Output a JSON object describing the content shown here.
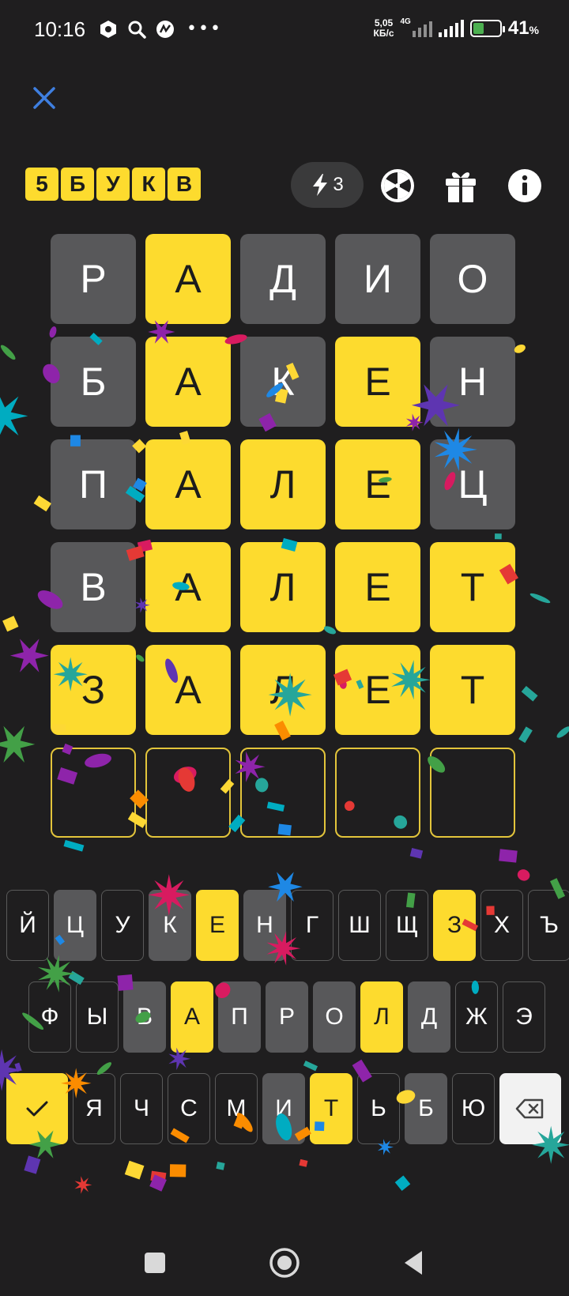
{
  "status_bar": {
    "time": "10:16",
    "speed_value": "5,05",
    "speed_unit": "КБ/с",
    "network": "4G",
    "battery_pct": "41",
    "battery_unit": "%",
    "battery_level": 0.41
  },
  "header": {
    "logo_letters": [
      "5",
      "Б",
      "У",
      "К",
      "В"
    ],
    "energy_count": "3"
  },
  "grid": {
    "rows": [
      [
        {
          "l": "Р",
          "s": "gray"
        },
        {
          "l": "А",
          "s": "yellow"
        },
        {
          "l": "Д",
          "s": "gray"
        },
        {
          "l": "И",
          "s": "gray"
        },
        {
          "l": "О",
          "s": "gray"
        }
      ],
      [
        {
          "l": "Б",
          "s": "gray"
        },
        {
          "l": "А",
          "s": "yellow"
        },
        {
          "l": "К",
          "s": "gray"
        },
        {
          "l": "Е",
          "s": "yellow"
        },
        {
          "l": "Н",
          "s": "gray"
        }
      ],
      [
        {
          "l": "П",
          "s": "gray"
        },
        {
          "l": "А",
          "s": "yellow"
        },
        {
          "l": "Л",
          "s": "yellow"
        },
        {
          "l": "Е",
          "s": "yellow"
        },
        {
          "l": "Ц",
          "s": "gray"
        }
      ],
      [
        {
          "l": "В",
          "s": "gray"
        },
        {
          "l": "А",
          "s": "yellow"
        },
        {
          "l": "Л",
          "s": "yellow"
        },
        {
          "l": "Е",
          "s": "yellow"
        },
        {
          "l": "Т",
          "s": "yellow"
        }
      ],
      [
        {
          "l": "З",
          "s": "yellow"
        },
        {
          "l": "А",
          "s": "yellow"
        },
        {
          "l": "Л",
          "s": "yellow"
        },
        {
          "l": "Е",
          "s": "yellow"
        },
        {
          "l": "Т",
          "s": "yellow"
        }
      ],
      [
        {
          "l": "",
          "s": "empty"
        },
        {
          "l": "",
          "s": "empty"
        },
        {
          "l": "",
          "s": "empty"
        },
        {
          "l": "",
          "s": "empty"
        },
        {
          "l": "",
          "s": "empty"
        }
      ]
    ]
  },
  "keyboard": {
    "rows": [
      [
        {
          "k": "Й",
          "s": ""
        },
        {
          "k": "Ц",
          "s": "g"
        },
        {
          "k": "У",
          "s": ""
        },
        {
          "k": "К",
          "s": "g"
        },
        {
          "k": "Е",
          "s": "y"
        },
        {
          "k": "Н",
          "s": "g"
        },
        {
          "k": "Г",
          "s": ""
        },
        {
          "k": "Ш",
          "s": ""
        },
        {
          "k": "Щ",
          "s": ""
        },
        {
          "k": "З",
          "s": "y"
        },
        {
          "k": "Х",
          "s": ""
        },
        {
          "k": "Ъ",
          "s": ""
        }
      ],
      [
        {
          "k": "Ф",
          "s": ""
        },
        {
          "k": "Ы",
          "s": ""
        },
        {
          "k": "В",
          "s": "g"
        },
        {
          "k": "А",
          "s": "y"
        },
        {
          "k": "П",
          "s": "g"
        },
        {
          "k": "Р",
          "s": "g"
        },
        {
          "k": "О",
          "s": "g"
        },
        {
          "k": "Л",
          "s": "y"
        },
        {
          "k": "Д",
          "s": "g"
        },
        {
          "k": "Ж",
          "s": ""
        },
        {
          "k": "Э",
          "s": ""
        }
      ],
      [
        {
          "k": "Я",
          "s": ""
        },
        {
          "k": "Ч",
          "s": ""
        },
        {
          "k": "С",
          "s": ""
        },
        {
          "k": "М",
          "s": ""
        },
        {
          "k": "И",
          "s": "g"
        },
        {
          "k": "Т",
          "s": "y"
        },
        {
          "k": "Ь",
          "s": ""
        },
        {
          "k": "Б",
          "s": "g"
        },
        {
          "k": "Ю",
          "s": ""
        }
      ]
    ]
  },
  "icons": {
    "close": "close-icon",
    "energy": "lightning-icon",
    "wheel": "fortune-wheel-icon",
    "gift": "gift-icon",
    "info": "info-icon",
    "enter": "checkmark-icon",
    "backspace": "backspace-icon"
  },
  "colors": {
    "background": "#1f1e1f",
    "accent_yellow": "#fddb2e",
    "absent_gray": "#58585a",
    "close_blue": "#3f7fe0"
  }
}
